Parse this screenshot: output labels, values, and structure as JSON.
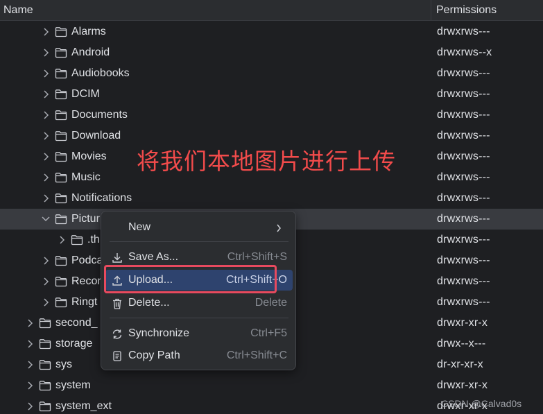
{
  "header": {
    "name": "Name",
    "permissions": "Permissions"
  },
  "rows": [
    {
      "name": "Alarms",
      "perm": "drwxrws---",
      "level": 2,
      "expanded": false
    },
    {
      "name": "Android",
      "perm": "drwxrws--x",
      "level": 2,
      "expanded": false
    },
    {
      "name": "Audiobooks",
      "perm": "drwxrws---",
      "level": 2,
      "expanded": false
    },
    {
      "name": "DCIM",
      "perm": "drwxrws---",
      "level": 2,
      "expanded": false
    },
    {
      "name": "Documents",
      "perm": "drwxrws---",
      "level": 2,
      "expanded": false
    },
    {
      "name": "Download",
      "perm": "drwxrws---",
      "level": 2,
      "expanded": false
    },
    {
      "name": "Movies",
      "perm": "drwxrws---",
      "level": 2,
      "expanded": false
    },
    {
      "name": "Music",
      "perm": "drwxrws---",
      "level": 2,
      "expanded": false
    },
    {
      "name": "Notifications",
      "perm": "drwxrws---",
      "level": 2,
      "expanded": false
    },
    {
      "name": "Pictur",
      "perm": "drwxrws---",
      "level": 2,
      "expanded": true,
      "selected": true
    },
    {
      "name": ".th",
      "perm": "drwxrws---",
      "level": 3,
      "expanded": false
    },
    {
      "name": "Podca",
      "perm": "drwxrws---",
      "level": 2,
      "expanded": false
    },
    {
      "name": "Recor",
      "perm": "drwxrws---",
      "level": 2,
      "expanded": false
    },
    {
      "name": "Ringt",
      "perm": "drwxrws---",
      "level": 2,
      "expanded": false
    },
    {
      "name": "second_",
      "perm": "drwxr-xr-x",
      "level": 1,
      "expanded": false
    },
    {
      "name": "storage",
      "perm": "drwx--x---",
      "level": 1,
      "expanded": false
    },
    {
      "name": "sys",
      "perm": "dr-xr-xr-x",
      "level": 1,
      "expanded": false
    },
    {
      "name": "system",
      "perm": "drwxr-xr-x",
      "level": 1,
      "expanded": false
    },
    {
      "name": "system_ext",
      "perm": "drwxr-xr-x",
      "level": 1,
      "expanded": false
    }
  ],
  "annotation": "将我们本地图片进行上传",
  "menu": {
    "new": {
      "label": "New",
      "icon": "submenu-arrow-icon"
    },
    "save_as": {
      "label": "Save As...",
      "shortcut": "Ctrl+Shift+S",
      "icon": "download-icon"
    },
    "upload": {
      "label": "Upload...",
      "shortcut": "Ctrl+Shift+O",
      "icon": "upload-icon"
    },
    "delete": {
      "label": "Delete...",
      "shortcut": "Delete",
      "icon": "trash-icon"
    },
    "synchronize": {
      "label": "Synchronize",
      "shortcut": "Ctrl+F5",
      "icon": "sync-icon"
    },
    "copy_path": {
      "label": "Copy Path",
      "shortcut": "Ctrl+Shift+C",
      "icon": "copy-icon"
    }
  },
  "watermark": "CSDN @Calvad0s",
  "colors": {
    "background": "#1e1f22",
    "selection": "#393b40",
    "menu_active": "#2e436e",
    "annotation": "#f24b4b",
    "highlight": "#e84a5f"
  }
}
